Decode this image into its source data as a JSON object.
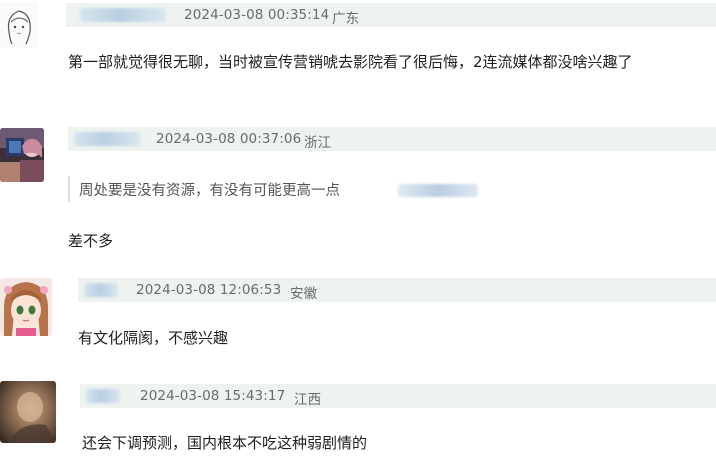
{
  "comments": [
    {
      "avatar_icon": "sketch-girl-avatar-icon",
      "timestamp": "2024-03-08 00:35:14",
      "location": "广东",
      "text": "第一部就觉得很无聊，当时被宣传营销唬去影院看了很后悔，2连流媒体都没啥兴趣了"
    },
    {
      "avatar_icon": "anime-photo-avatar-icon",
      "timestamp": "2024-03-08 00:37:06",
      "location": "浙江",
      "quote": "周处要是没有资源，有没有可能更高一点",
      "text": "差不多"
    },
    {
      "avatar_icon": "anime-girl-avatar-icon",
      "timestamp": "2024-03-08 12:06:53",
      "location": "安徽",
      "text": "有文化隔阂，不感兴趣"
    },
    {
      "avatar_icon": "blurred-photo-avatar-icon",
      "timestamp": "2024-03-08 15:43:17",
      "location": "江西",
      "text": "还会下调预测，国内根本不吃这种弱剧情的"
    }
  ],
  "colors": {
    "meta_bar_bg": "#eef3f0",
    "meta_text": "#6b6b6b",
    "comment_text": "#1f1f1f"
  }
}
